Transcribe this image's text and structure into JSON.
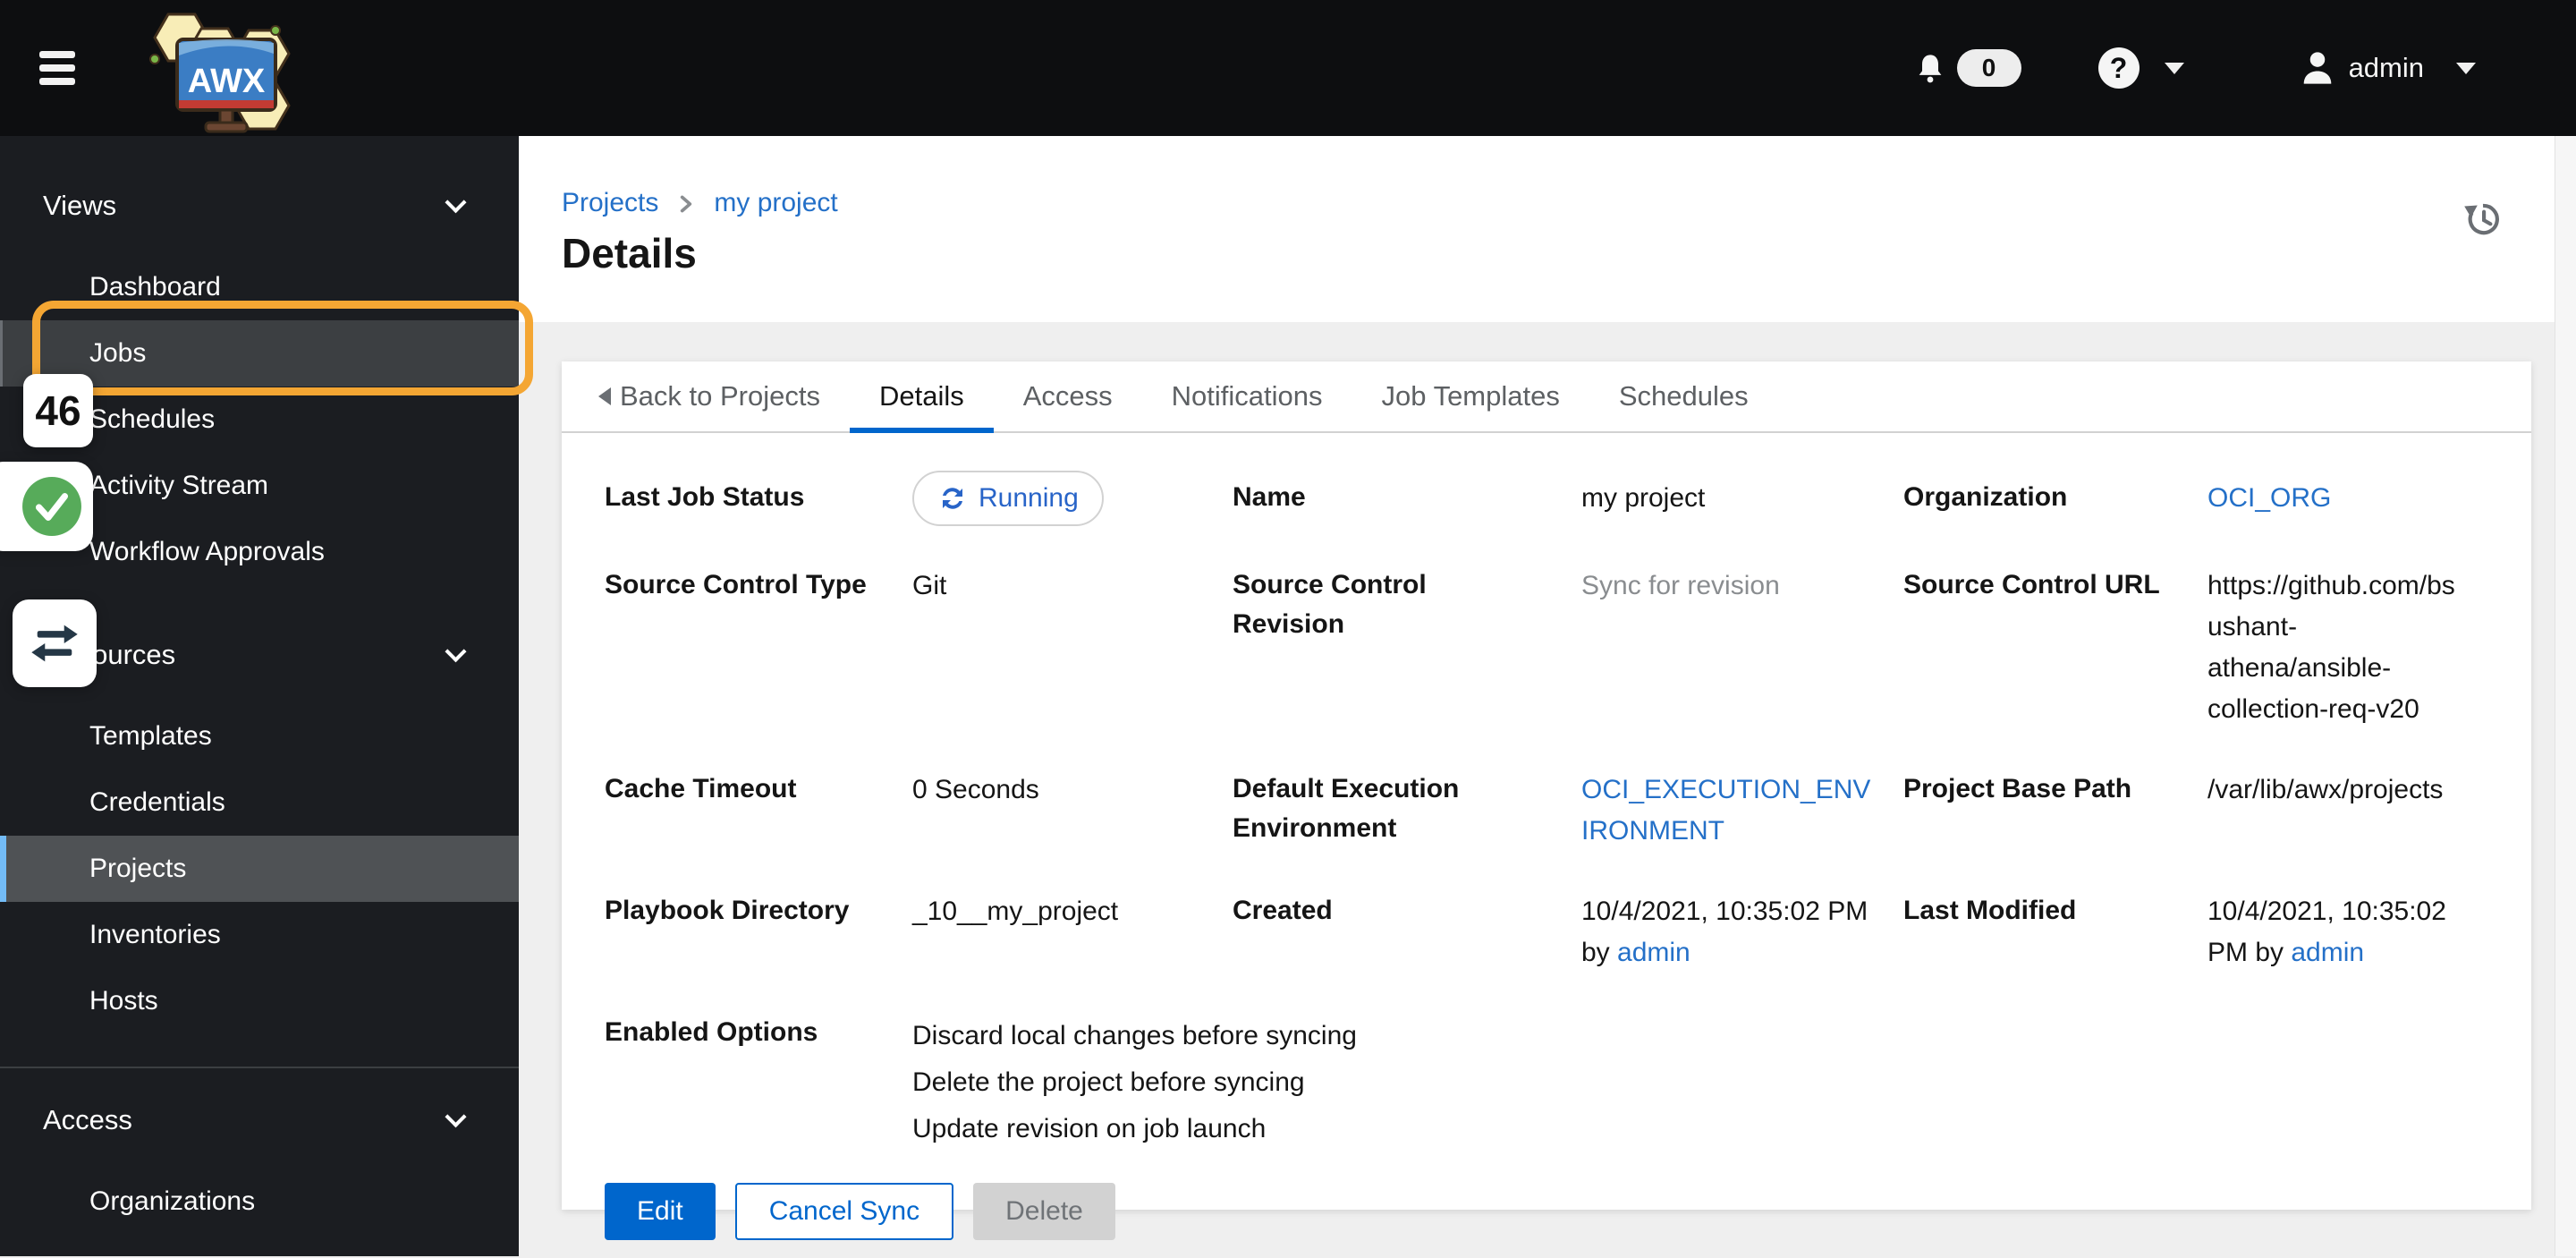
{
  "masthead": {
    "notification_count": "0",
    "help_symbol": "?",
    "user": "admin"
  },
  "sidebar": {
    "groups": [
      {
        "label": "Views",
        "items": [
          "Dashboard",
          "Jobs",
          "Schedules",
          "Activity Stream",
          "Workflow Approvals"
        ]
      },
      {
        "label": "Resources",
        "items": [
          "Templates",
          "Credentials",
          "Projects",
          "Inventories",
          "Hosts"
        ]
      },
      {
        "label": "Access",
        "items": [
          "Organizations"
        ]
      }
    ],
    "hovered_item": "Jobs",
    "selected_item": "Projects"
  },
  "annotations": {
    "step_badge": "46",
    "highlighted_item": "Jobs"
  },
  "page": {
    "breadcrumb": {
      "parent": "Projects",
      "current": "my project"
    },
    "title": "Details"
  },
  "tabs": {
    "back": "Back to Projects",
    "items": [
      "Details",
      "Access",
      "Notifications",
      "Job Templates",
      "Schedules"
    ],
    "active": "Details"
  },
  "details": {
    "fields": [
      {
        "label": "Last Job Status",
        "type": "badge",
        "value": "Running"
      },
      {
        "label": "Name",
        "value": "my project"
      },
      {
        "label": "Organization",
        "type": "link",
        "value": "OCI_ORG"
      },
      {
        "label": "Source Control Type",
        "value": "Git"
      },
      {
        "label": "Source Control Revision",
        "type": "muted",
        "value": "Sync for revision"
      },
      {
        "label": "Source Control URL",
        "value": "https://github.com/bsushant-athena/ansible-collection-req-v20"
      },
      {
        "label": "Cache Timeout",
        "value": "0 Seconds"
      },
      {
        "label": "Default Execution Environment",
        "type": "link",
        "value": "OCI_EXECUTION_ENVIRONMENT"
      },
      {
        "label": "Project Base Path",
        "value": "/var/lib/awx/projects"
      },
      {
        "label": "Playbook Directory",
        "value": "_10__my_project"
      },
      {
        "label": "Created",
        "value": "10/4/2021, 10:35:02 PM by ",
        "link": "admin"
      },
      {
        "label": "Last Modified",
        "value": "10/4/2021, 10:35:02 PM by ",
        "link": "admin"
      },
      {
        "label": "Enabled Options",
        "options": [
          "Discard local changes before syncing",
          "Delete the project before syncing",
          "Update revision on job launch"
        ]
      }
    ]
  },
  "actions": {
    "edit": "Edit",
    "cancel_sync": "Cancel Sync",
    "delete": "Delete"
  },
  "icons": {
    "menu": "hamburger-icon",
    "logo": "awx-logo",
    "notifications": "bell-icon",
    "help": "question-circle-icon",
    "user": "person-icon",
    "history": "history-clock-icon",
    "status_running": "sync-icon",
    "annotation_success": "green-check-icon",
    "annotation_swap": "swap-arrows-icon"
  },
  "colors": {
    "masthead_bg": "#0d0e10",
    "sidebar_bg": "#1b1d21",
    "selected_row": "#4f5255",
    "selected_accent": "#73bcf7",
    "hover_row": "#3c3f42",
    "annotation_orange": "#f4a633",
    "link_blue": "#2470c8",
    "primary_blue": "#0066cc",
    "running_blue": "#2864c8",
    "success_green": "#57ab5a",
    "muted_text": "#8a8d90",
    "card_bg": "#ffffff",
    "body_bg": "#efefef"
  }
}
